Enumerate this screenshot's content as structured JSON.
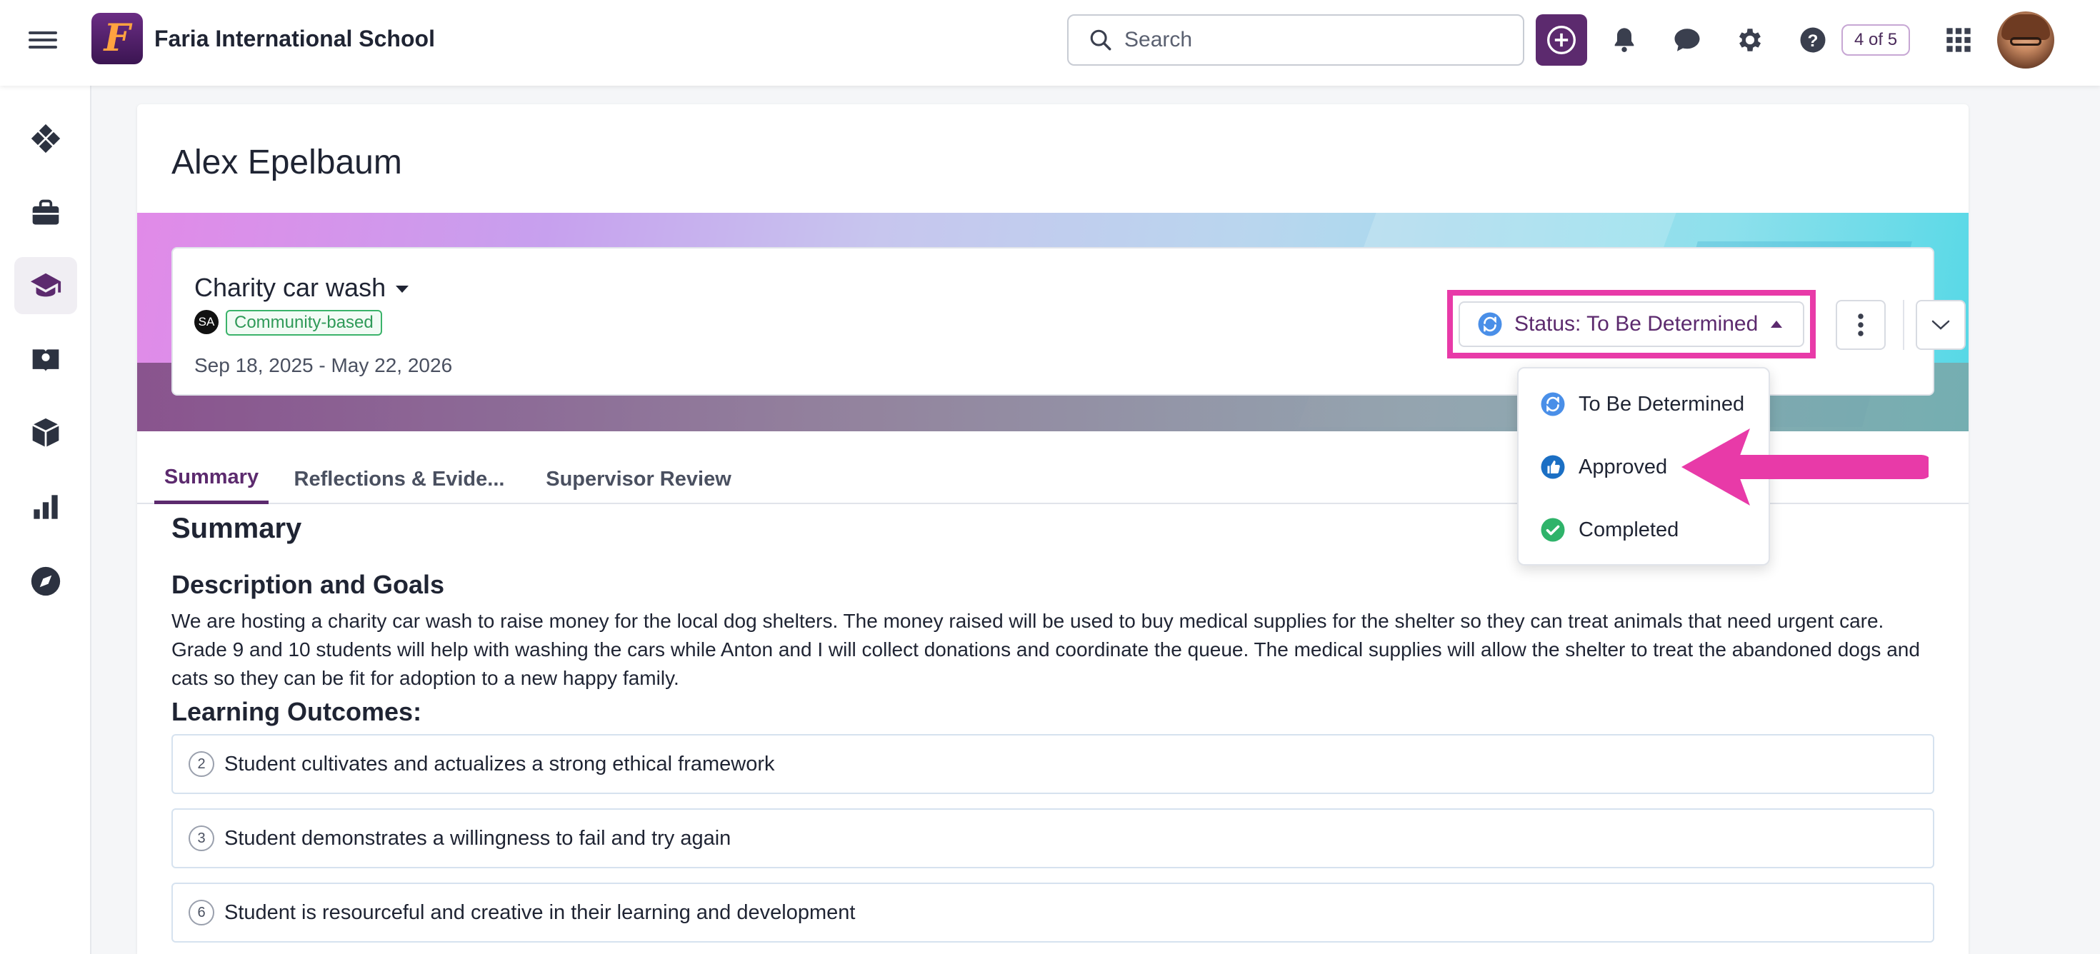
{
  "header": {
    "logo_letter": "F",
    "school_name": "Faria International School",
    "search_placeholder": "Search",
    "page_counter": "4 of 5"
  },
  "sidebar": {
    "items": [
      {
        "name": "dashboard-icon"
      },
      {
        "name": "briefcase-icon"
      },
      {
        "name": "graduation-cap-icon",
        "active": true
      },
      {
        "name": "map-book-icon"
      },
      {
        "name": "cube-icon"
      },
      {
        "name": "bar-chart-icon"
      },
      {
        "name": "compass-icon"
      }
    ]
  },
  "student": {
    "name": "Alex Epelbaum"
  },
  "activity": {
    "title": "Charity car wash",
    "initials": "SA",
    "tag": "Community-based",
    "dates": "Sep 18, 2025 - May 22, 2026",
    "status_label": "Status: To Be Determined"
  },
  "status_menu": {
    "options": [
      {
        "label": "To Be Determined",
        "icon": "sync-icon",
        "color": "#4a8fe8"
      },
      {
        "label": "Approved",
        "icon": "thumbs-up-icon",
        "color": "#1b6fc4"
      },
      {
        "label": "Completed",
        "icon": "check-circle-icon",
        "color": "#2fb36a"
      }
    ]
  },
  "tabs": [
    {
      "label": "Summary",
      "active": true
    },
    {
      "label": "Reflections & Evide..."
    },
    {
      "label": "Supervisor Review"
    }
  ],
  "summary": {
    "heading": "Summary",
    "description_heading": "Description and Goals",
    "description": "We are hosting a charity car wash to raise money for the local dog shelters. The money raised will be used to buy medical supplies for the shelter so they can treat animals that need urgent care. Grade 9 and 10 students will help with washing the cars while Anton and I will collect donations and coordinate the queue. The medical supplies will allow the shelter to treat the abandoned dogs and cats so they can be fit for adoption to a new happy family.",
    "outcomes_heading": "Learning Outcomes:",
    "outcomes": [
      {
        "num": "2",
        "text": "Student cultivates and actualizes a strong ethical framework"
      },
      {
        "num": "3",
        "text": "Student demonstrates a willingness to fail and try again"
      },
      {
        "num": "6",
        "text": "Student is resourceful and creative in their learning and development"
      }
    ]
  },
  "colors": {
    "brand": "#5c2a6e",
    "highlight": "#e83aa8"
  }
}
